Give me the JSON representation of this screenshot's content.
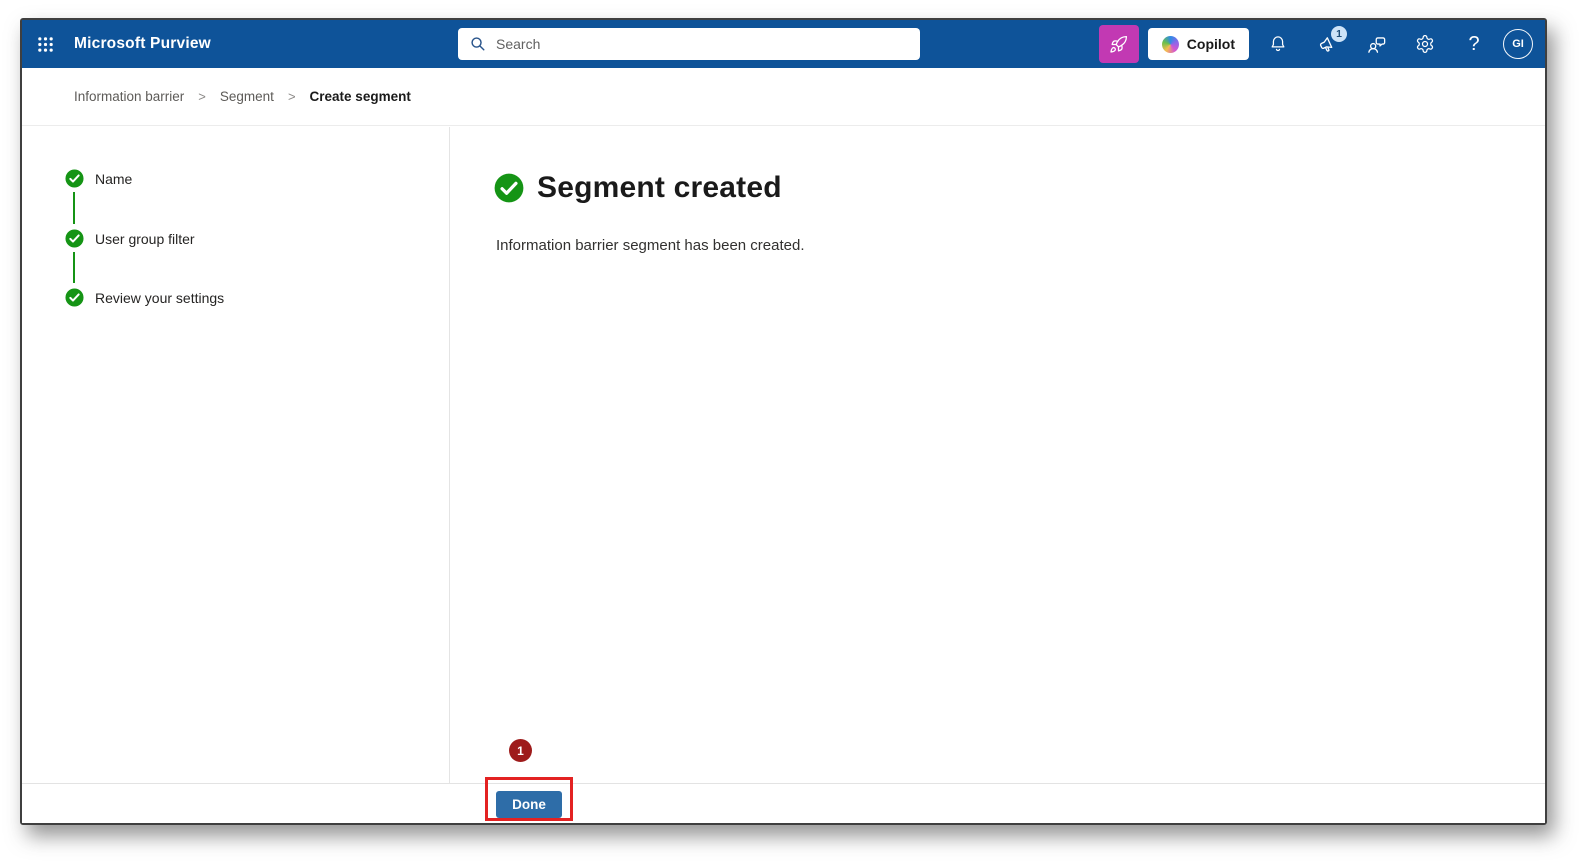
{
  "topbar": {
    "product_name": "Microsoft Purview",
    "search": {
      "placeholder": "Search"
    },
    "copilot_button": {
      "label": "Copilot"
    },
    "announcements_badge_count": "1",
    "help_glyph": "?",
    "avatar_initials": "GI"
  },
  "breadcrumb": {
    "separator": ">",
    "items": [
      {
        "label": "Information barrier",
        "current": false
      },
      {
        "label": "Segment",
        "current": false
      },
      {
        "label": "Create segment",
        "current": true
      }
    ]
  },
  "wizard_steps": [
    {
      "label": "Name",
      "status": "completed"
    },
    {
      "label": "User group filter",
      "status": "completed"
    },
    {
      "label": "Review your settings",
      "status": "completed"
    }
  ],
  "main": {
    "title": "Segment created",
    "message": "Information barrier segment has been created."
  },
  "footer": {
    "done_button_label": "Done"
  },
  "annotations": {
    "callout_number": "1"
  },
  "colors": {
    "topbar_blue": "#0E5399",
    "success_green": "#159415",
    "copilot_magenta": "#C239B3",
    "primary_button_blue": "#2E6DA8",
    "annotation_red": "#E32222",
    "annotation_circle_red": "#9E1B1B"
  }
}
